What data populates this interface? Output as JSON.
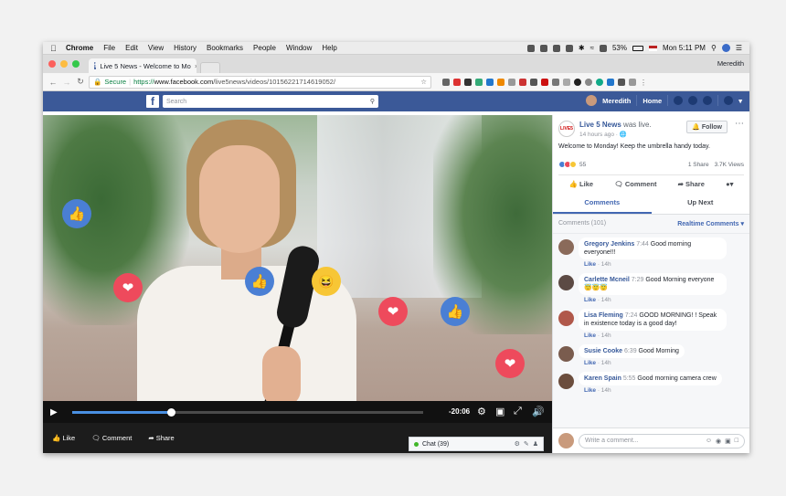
{
  "menubar": {
    "app": "Chrome",
    "items": [
      "File",
      "Edit",
      "View",
      "History",
      "Bookmarks",
      "People",
      "Window",
      "Help"
    ],
    "battery": "53%",
    "clock": "Mon 5:11 PM"
  },
  "browser": {
    "tab_title": "Live 5 News - Welcome to Mo",
    "tab_close": "×",
    "profile": "Meredith",
    "secure_label": "Secure",
    "url_scheme": "https://",
    "url_host": "www.facebook.com",
    "url_path": "/live5news/videos/10156221714619052/"
  },
  "fb_header": {
    "logo": "f",
    "search_placeholder": "Search",
    "user": "Meredith",
    "home": "Home"
  },
  "video": {
    "time_remaining": "-20:06",
    "progress": 0.28,
    "actions": {
      "like": "Like",
      "comment": "Comment",
      "share": "Share"
    },
    "chat_label": "Chat (39)",
    "reactions": [
      "like",
      "love",
      "like",
      "haha",
      "love",
      "like",
      "love"
    ]
  },
  "post": {
    "page_name": "Live 5 News",
    "status": "was live.",
    "time": "14 hours ago",
    "message": "Welcome to Monday! Keep the umbrella handy today.",
    "follow_label": "Follow",
    "reaction_count": "55",
    "shares": "1 Share",
    "views": "3.7K Views",
    "actions": {
      "like": "Like",
      "comment": "Comment",
      "share": "Share"
    },
    "tabs": {
      "comments": "Comments",
      "upnext": "Up Next"
    },
    "comments_count": "Comments (101)",
    "sort_label": "Realtime Comments",
    "write_placeholder": "Write a comment..."
  },
  "comments": [
    {
      "name": "Gregory Jenkins",
      "time": "7:44",
      "text": "Good morning everyone!!!",
      "like": "Like",
      "ago": "14h",
      "avatar_color": "#8a6a5a"
    },
    {
      "name": "Carlette Mcneil",
      "time": "7:29",
      "text": "Good Morning everyone 😇😇😇",
      "like": "Like",
      "ago": "14h",
      "avatar_color": "#5c4a44"
    },
    {
      "name": "Lisa Fleming",
      "time": "7:24",
      "text": "GOOD MORNING! ! Speak in existence today is a good day!",
      "like": "Like",
      "ago": "14h",
      "avatar_color": "#b0584a"
    },
    {
      "name": "Susie Cooke",
      "time": "6:39",
      "text": "Good Morning",
      "like": "Like",
      "ago": "14h",
      "avatar_color": "#7a5c4e"
    },
    {
      "name": "Karen Spain",
      "time": "5:55",
      "text": "Good morning camera crew",
      "like": "Like",
      "ago": "14h",
      "avatar_color": "#6b4d3d"
    }
  ],
  "colors": {
    "fb_blue": "#3b5998",
    "link_blue": "#365899",
    "love_red": "#ee4a5c",
    "like_blue": "#4a7fd4"
  }
}
